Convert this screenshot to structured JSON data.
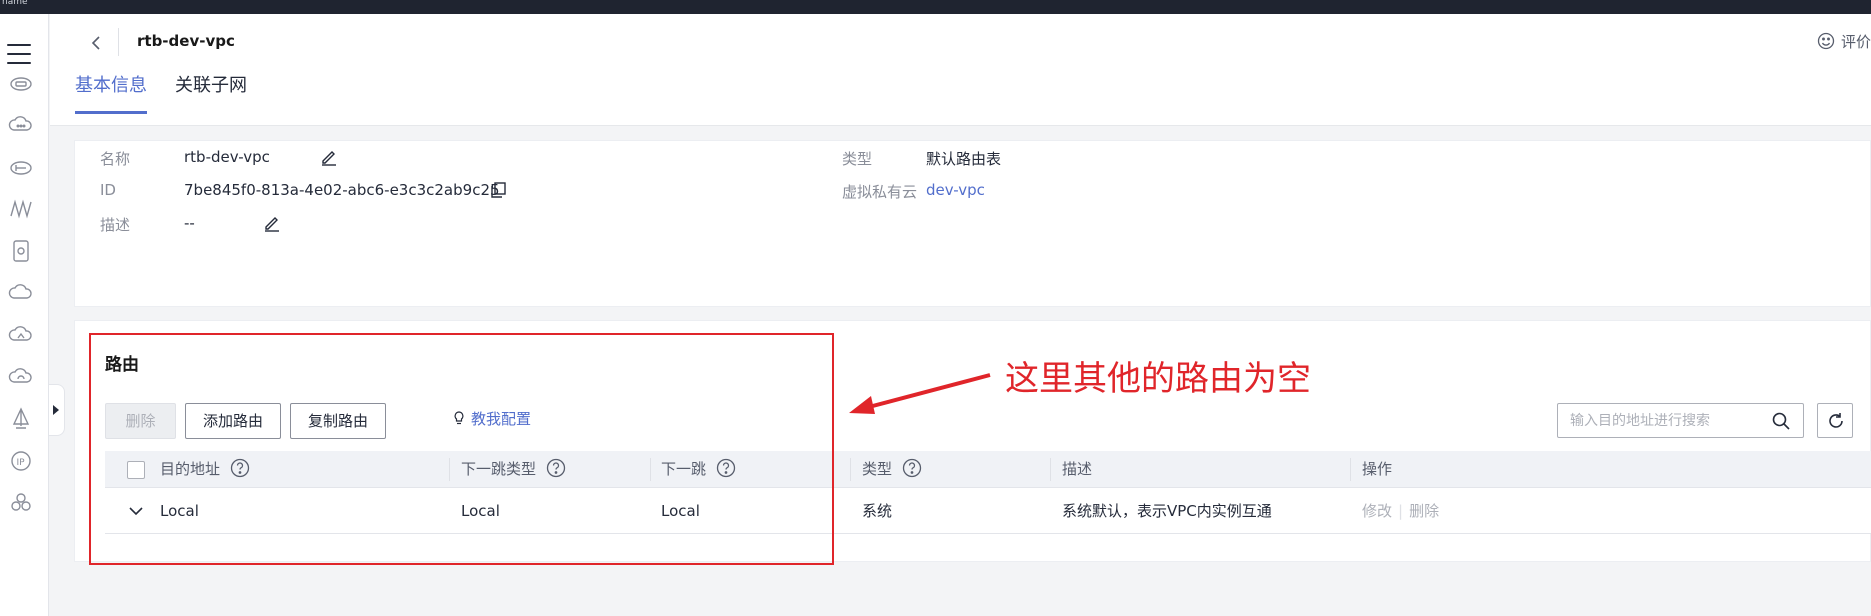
{
  "topbar": {
    "text": "name"
  },
  "leftrail": {
    "icons": [
      "menu-icon",
      "elastic-cloud-server-icon",
      "cloud-icon",
      "storage-icon",
      "network-icon",
      "database-icon",
      "cloud-service-icon",
      "cloud-home-icon",
      "cloud-sync-icon",
      "sail-icon",
      "ip-icon",
      "hexagon-icon"
    ]
  },
  "header": {
    "back_icon": "back-arrow-icon",
    "title": "rtb-dev-vpc",
    "feedback": "评价"
  },
  "tabs": [
    {
      "label": "基本信息",
      "active": true
    },
    {
      "label": "关联子网",
      "active": false
    }
  ],
  "info": {
    "name_label": "名称",
    "name_value": "rtb-dev-vpc",
    "id_label": "ID",
    "id_value": "7be845f0-813a-4e02-abc6-e3c3c2ab9c25",
    "desc_label": "描述",
    "desc_value": "--",
    "type_label": "类型",
    "type_value": "默认路由表",
    "vpc_label": "虚拟私有云",
    "vpc_value": "dev-vpc"
  },
  "routes": {
    "title": "路由",
    "delete_button": "删除",
    "add_button": "添加路由",
    "copy_button": "复制路由",
    "help_link": "教我配置",
    "search_placeholder": "输入目的地址进行搜索",
    "columns": {
      "destination": "目的地址",
      "next_hop_type": "下一跳类型",
      "next_hop": "下一跳",
      "type": "类型",
      "description": "描述",
      "actions": "操作"
    },
    "rows": [
      {
        "destination": "Local",
        "next_hop_type": "Local",
        "next_hop": "Local",
        "type": "系统",
        "description": "系统默认，表示VPC内实例互通",
        "action_modify": "修改",
        "action_separator": "|",
        "action_delete": "删除"
      }
    ]
  },
  "annotation": {
    "text": "这里其他的路由为空",
    "color": "#e0252a"
  },
  "colors": {
    "accent": "#526ecc",
    "annotation": "#e0252a",
    "topbar": "#1f2430"
  }
}
